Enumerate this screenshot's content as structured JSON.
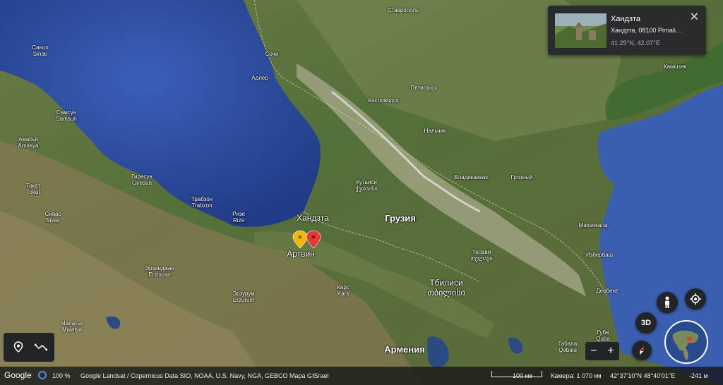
{
  "map": {
    "sea_labels": [],
    "places": [
      {
        "name": "Ставрополь",
        "latin": ""
      },
      {
        "name": "Синоп",
        "latin": "Sinop"
      },
      {
        "name": "Сочи",
        "latin": ""
      },
      {
        "name": "Адлер",
        "latin": ""
      },
      {
        "name": "Пятигорск",
        "latin": ""
      },
      {
        "name": "Кисловодск",
        "latin": ""
      },
      {
        "name": "Нальчик",
        "latin": ""
      },
      {
        "name": "Камызяк",
        "latin": ""
      },
      {
        "name": "Самсун",
        "latin": "Samsun"
      },
      {
        "name": "Амасья",
        "latin": "Amasya"
      },
      {
        "name": "Гиресун",
        "latin": "Giresun"
      },
      {
        "name": "Кутаиси",
        "latin": "ქუთაისი"
      },
      {
        "name": "Владикавказ",
        "latin": ""
      },
      {
        "name": "Грозный",
        "latin": ""
      },
      {
        "name": "Токат",
        "latin": "Tokat"
      },
      {
        "name": "Трабзон",
        "latin": "Trabzon"
      },
      {
        "name": "Сивас",
        "latin": "Sivas"
      },
      {
        "name": "Ризе",
        "latin": "Rize"
      },
      {
        "name": "Махачкала",
        "latin": ""
      },
      {
        "name": "Телави",
        "latin": "თელავი"
      },
      {
        "name": "Избербаш",
        "latin": ""
      },
      {
        "name": "Эрзинджан",
        "latin": "Erzincan"
      },
      {
        "name": "Карс",
        "latin": "Kars"
      },
      {
        "name": "Дербент",
        "latin": ""
      },
      {
        "name": "Эрзурум",
        "latin": "Erzurum"
      },
      {
        "name": "Малатья",
        "latin": "Malatya"
      },
      {
        "name": "Габала",
        "latin": "Qəbələ"
      },
      {
        "name": "Губа",
        "latin": "Quba"
      }
    ],
    "big_labels": {
      "khandzta": "Хандзта",
      "georgia": "Грузия",
      "artvin": "Артвин",
      "tbilisi": "Тбилиси",
      "tbilisi_geo": "თბილისი",
      "armenia": "Армения"
    }
  },
  "card": {
    "title": "Хандзта",
    "address": "Хандзта, 08100 Pirnali…",
    "coords": "41.25°N, 42.07°E",
    "close": "✕"
  },
  "controls": {
    "btn_3d": "3D",
    "zoom_out": "−",
    "zoom_in": "+"
  },
  "status": {
    "logo": "Google",
    "zoom": "100 %",
    "attribution": "Google  Landsat / Copernicus  Data SIO, NOAA, U.S. Navy, NGA, GEBCO  Mapa GISrael",
    "scale": "100 км",
    "camera": "Камера: 1 070 км",
    "coords": "42°37'10\"N 48°40'01\"E",
    "elevation": "-241 м"
  },
  "colors": {
    "sea": "#2f4fa0",
    "land": "#4f6a34",
    "mountains": "#8c8f6e",
    "pin_yellow": "#f2b705",
    "pin_red": "#e53935"
  }
}
